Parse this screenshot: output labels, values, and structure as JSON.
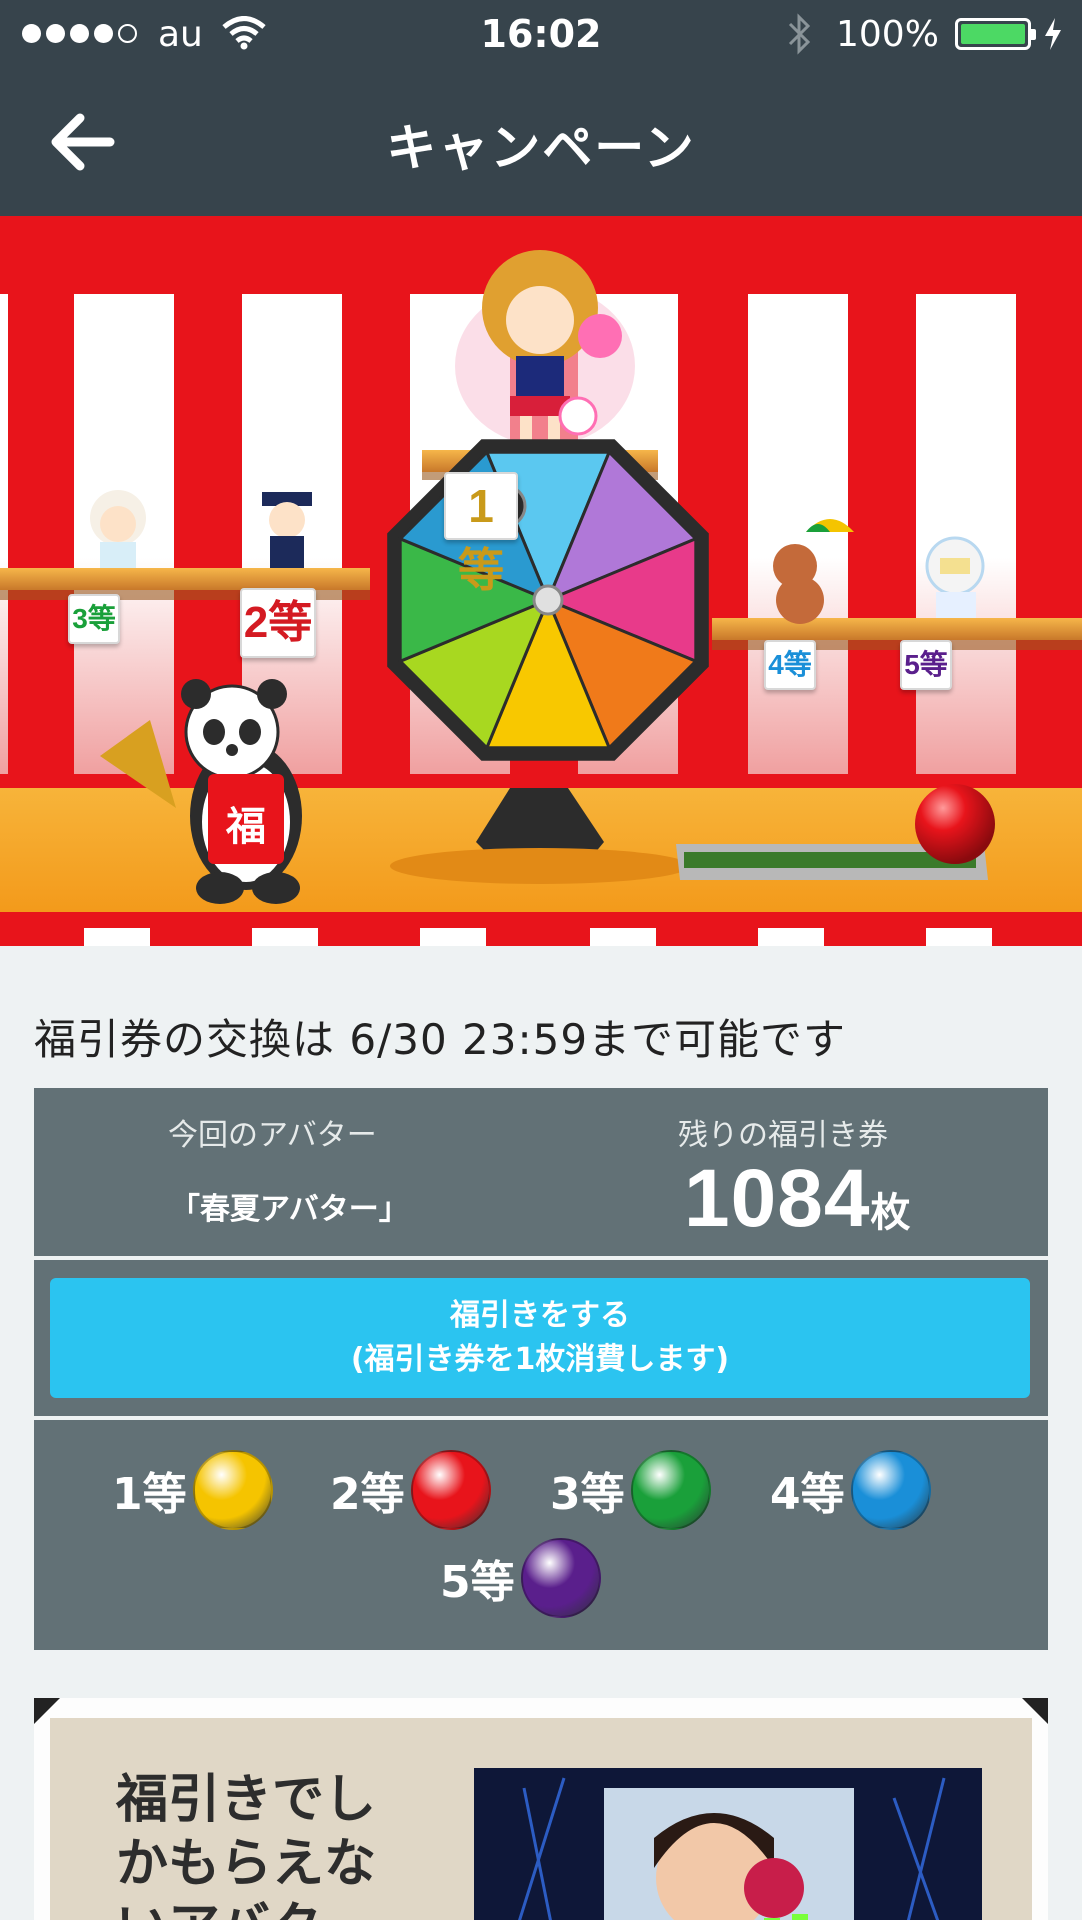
{
  "status_bar": {
    "carrier": "au",
    "time": "16:02",
    "battery": "100%",
    "battery_level": 1.0
  },
  "nav": {
    "title": "キャンペーン",
    "back_icon": "arrow-left-icon"
  },
  "banner": {
    "prizes": [
      {
        "rank_label": "1等"
      },
      {
        "rank_label": "2等"
      },
      {
        "rank_label": "3等"
      },
      {
        "rank_label": "4等"
      },
      {
        "rank_label": "5等"
      }
    ],
    "panda_sash": "福",
    "colors": {
      "curtain_red": "#e8141b",
      "stage": "#f5a623"
    }
  },
  "info": {
    "deadline_text": "福引券の交換は 6/30 23:59まで可能です",
    "avatar_label": "今回のアバター",
    "avatar_name": "「春夏アバター」",
    "tickets_label": "残りの福引き券",
    "tickets_count": "1084",
    "tickets_unit": "枚"
  },
  "draw_button": {
    "line1": "福引きをする",
    "line2": "(福引き券を1枚消費します)",
    "color": "#2bc4f0"
  },
  "legend": [
    {
      "label": "1等",
      "color": "#f5c400"
    },
    {
      "label": "2等",
      "color": "#e8141b"
    },
    {
      "label": "3等",
      "color": "#1aa03a"
    },
    {
      "label": "4等",
      "color": "#1a8fd8"
    },
    {
      "label": "5等",
      "color": "#5a1f8c"
    }
  ],
  "promo": {
    "text": "福引きでしかもらえないアバタ"
  }
}
